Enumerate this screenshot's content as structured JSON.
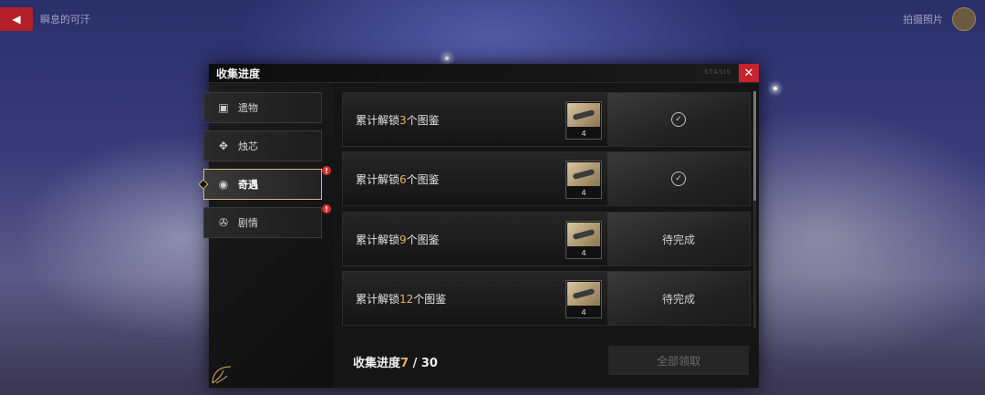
{
  "top": {
    "back_label": "◀",
    "left_title": "瞬息的可汗",
    "right_text": "拍摄照片",
    "avatar_icon": "avatar"
  },
  "panel": {
    "title": "收集进度",
    "header_deco": "STASIS",
    "close_label": "✕"
  },
  "sidebar": {
    "items": [
      {
        "label": "遗物",
        "icon": "relic-icon",
        "glyph": "▣",
        "active": false,
        "badge": ""
      },
      {
        "label": "烛芯",
        "icon": "wick-icon",
        "glyph": "✥",
        "active": false,
        "badge": ""
      },
      {
        "label": "奇遇",
        "icon": "encounter-icon",
        "glyph": "◉",
        "active": true,
        "badge": "!"
      },
      {
        "label": "剧情",
        "icon": "story-icon",
        "glyph": "✇",
        "active": false,
        "badge": "!"
      }
    ]
  },
  "rows": [
    {
      "prefix": "累计解锁",
      "num": "3",
      "suffix": "个图鉴",
      "reward_count": "4",
      "status": "done",
      "status_text": "✓"
    },
    {
      "prefix": "累计解锁",
      "num": "6",
      "suffix": "个图鉴",
      "reward_count": "4",
      "status": "done",
      "status_text": "✓"
    },
    {
      "prefix": "累计解锁",
      "num": "9",
      "suffix": "个图鉴",
      "reward_count": "4",
      "status": "pending",
      "status_text": "待完成"
    },
    {
      "prefix": "累计解锁",
      "num": "12",
      "suffix": "个图鉴",
      "reward_count": "4",
      "status": "pending",
      "status_text": "待完成"
    }
  ],
  "footer": {
    "progress_label": "收集进度",
    "current": "7",
    "separator": " / ",
    "total": "30",
    "claim_all_label": "全部领取"
  },
  "colors": {
    "accent_gold": "#e6b15a",
    "close_red": "#c8232c",
    "badge_red": "#d62a2a"
  }
}
